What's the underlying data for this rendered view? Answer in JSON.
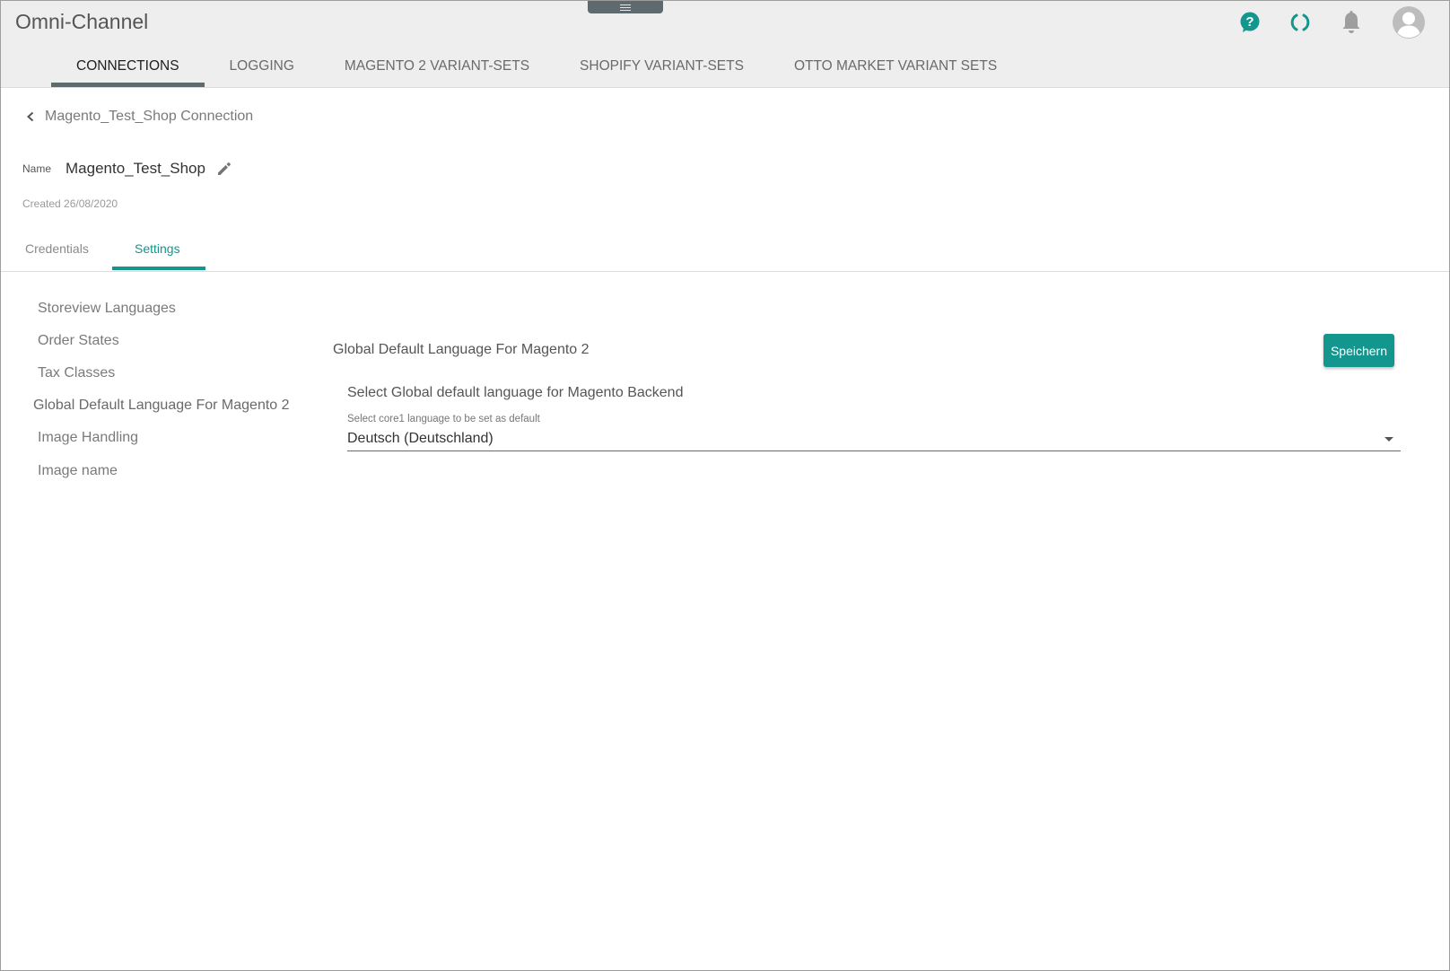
{
  "app": {
    "title": "Omni-Channel"
  },
  "icons": {
    "help": "help-icon",
    "loading": "loading-icon",
    "notifications": "bell-icon",
    "account": "avatar-icon",
    "menu_handle": "menu-icon",
    "back": "chevron-left-icon",
    "edit": "pencil-icon",
    "dropdown": "caret-down-icon"
  },
  "colors": {
    "accent": "#13968d",
    "active_tab_underline": "#5f6a6e",
    "topbar_bg": "#eeeeee"
  },
  "nav": {
    "tabs": [
      {
        "label": "CONNECTIONS",
        "active": true
      },
      {
        "label": "LOGGING",
        "active": false
      },
      {
        "label": "MAGENTO 2 VARIANT-SETS",
        "active": false
      },
      {
        "label": "SHOPIFY VARIANT-SETS",
        "active": false
      },
      {
        "label": "OTTO MARKET VARIANT SETS",
        "active": false
      }
    ]
  },
  "breadcrumb": {
    "text": "Magento_Test_Shop Connection"
  },
  "connection": {
    "name_label": "Name",
    "name_value": "Magento_Test_Shop",
    "created": "Created 26/08/2020"
  },
  "subtabs": [
    {
      "label": "Credentials",
      "active": false
    },
    {
      "label": "Settings",
      "active": true
    }
  ],
  "settings_nav": {
    "items": [
      {
        "label": "Storeview Languages",
        "active": false
      },
      {
        "label": "Order States",
        "active": false
      },
      {
        "label": "Tax Classes",
        "active": false
      },
      {
        "label": "Global Default Language For Magento 2",
        "active": true
      },
      {
        "label": "Image Handling",
        "active": false
      },
      {
        "label": "Image name",
        "active": false
      }
    ]
  },
  "section": {
    "title": "Global Default Language For Magento 2",
    "save_label": "Speichern",
    "field_heading": "Select Global default language for Magento Backend",
    "field_label": "Select core1 language to be set as default",
    "field_value": "Deutsch (Deutschland)"
  }
}
